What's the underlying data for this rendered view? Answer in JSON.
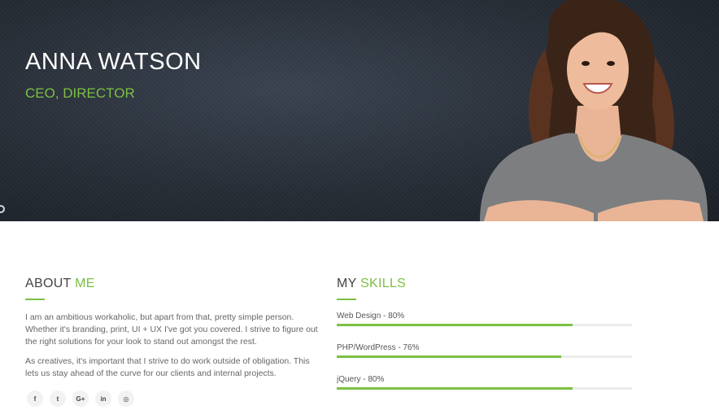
{
  "hero": {
    "name": "ANNA WATSON",
    "role": "CEO, DIRECTOR"
  },
  "about": {
    "title_main": "ABOUT ",
    "title_accent": "ME",
    "paragraphs": [
      "I am an ambitious workaholic, but apart from that, pretty simple person. Whether it's branding, print, UI + UX I've got you covered. I strive to figure out the right solutions for your look to stand out amongst the rest.",
      "As creatives, it's important that I strive to do work outside of obligation. This lets us stay ahead of the curve for our clients and internal projects."
    ],
    "social": [
      {
        "icon": "facebook-icon",
        "glyph": "f"
      },
      {
        "icon": "twitter-icon",
        "glyph": "t"
      },
      {
        "icon": "google-plus-icon",
        "glyph": "G+"
      },
      {
        "icon": "linkedin-icon",
        "glyph": "in"
      },
      {
        "icon": "instagram-icon",
        "glyph": "◎"
      }
    ]
  },
  "skills": {
    "title_main": "MY ",
    "title_accent": "SKILLS",
    "items": [
      {
        "label": "Web Design - 80%",
        "percent": 80
      },
      {
        "label": "PHP/WordPress - 76%",
        "percent": 76
      },
      {
        "label": "jQuery - 80%",
        "percent": 80
      }
    ]
  },
  "colors": {
    "accent": "#7bc043",
    "hero_bg": "#272d36"
  }
}
